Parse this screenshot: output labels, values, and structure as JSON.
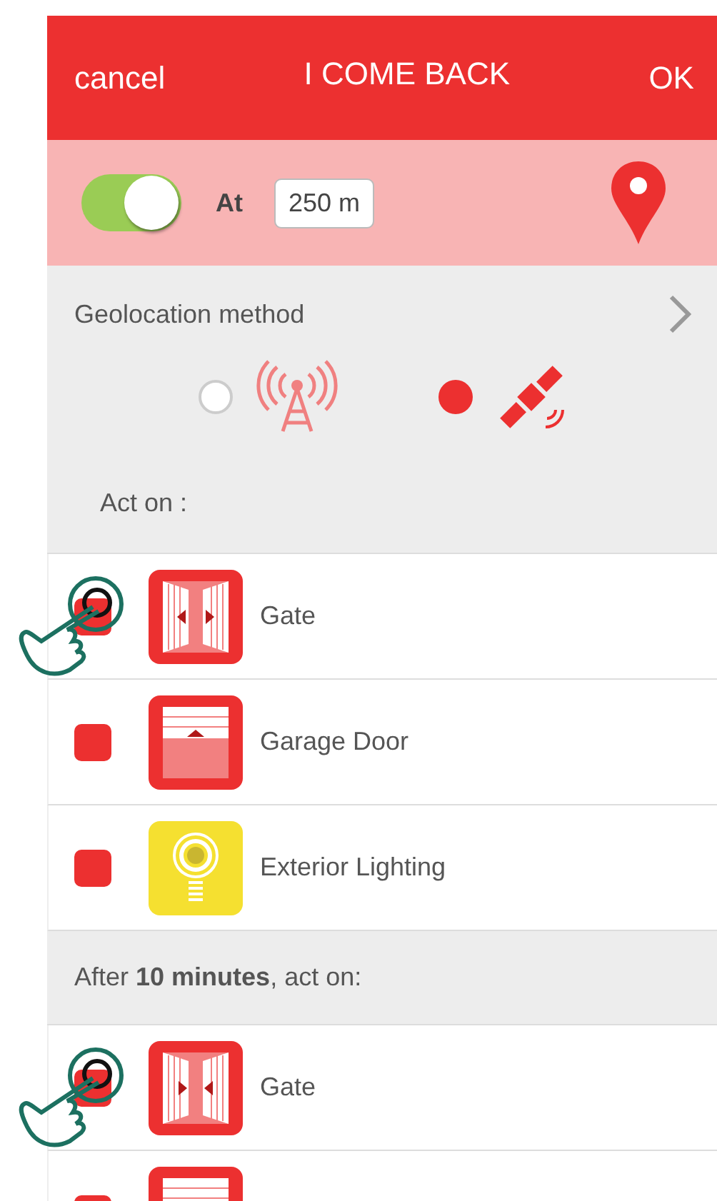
{
  "header": {
    "cancel": "cancel",
    "title": "I COME BACK",
    "ok": "OK"
  },
  "trigger": {
    "on": true,
    "label": "At",
    "distance": "250 m"
  },
  "geolocation": {
    "label": "Geolocation method",
    "options": [
      {
        "kind": "antenna",
        "selected": false
      },
      {
        "kind": "satellite",
        "selected": true
      }
    ]
  },
  "sections": [
    {
      "heading": "Act on :",
      "items": [
        {
          "kind": "gate-open",
          "label": "Gate",
          "checked": true,
          "tapped": true
        },
        {
          "kind": "garage",
          "label": "Garage Door",
          "checked": true,
          "tapped": false
        },
        {
          "kind": "light",
          "label": "Exterior Lighting",
          "checked": true,
          "tapped": false
        }
      ]
    },
    {
      "heading": "After **10 minutes**, act on:",
      "items": [
        {
          "kind": "gate-close",
          "label": "Gate",
          "checked": true,
          "tapped": true
        },
        {
          "kind": "garage",
          "checked": true,
          "tapped": false
        }
      ]
    }
  ]
}
